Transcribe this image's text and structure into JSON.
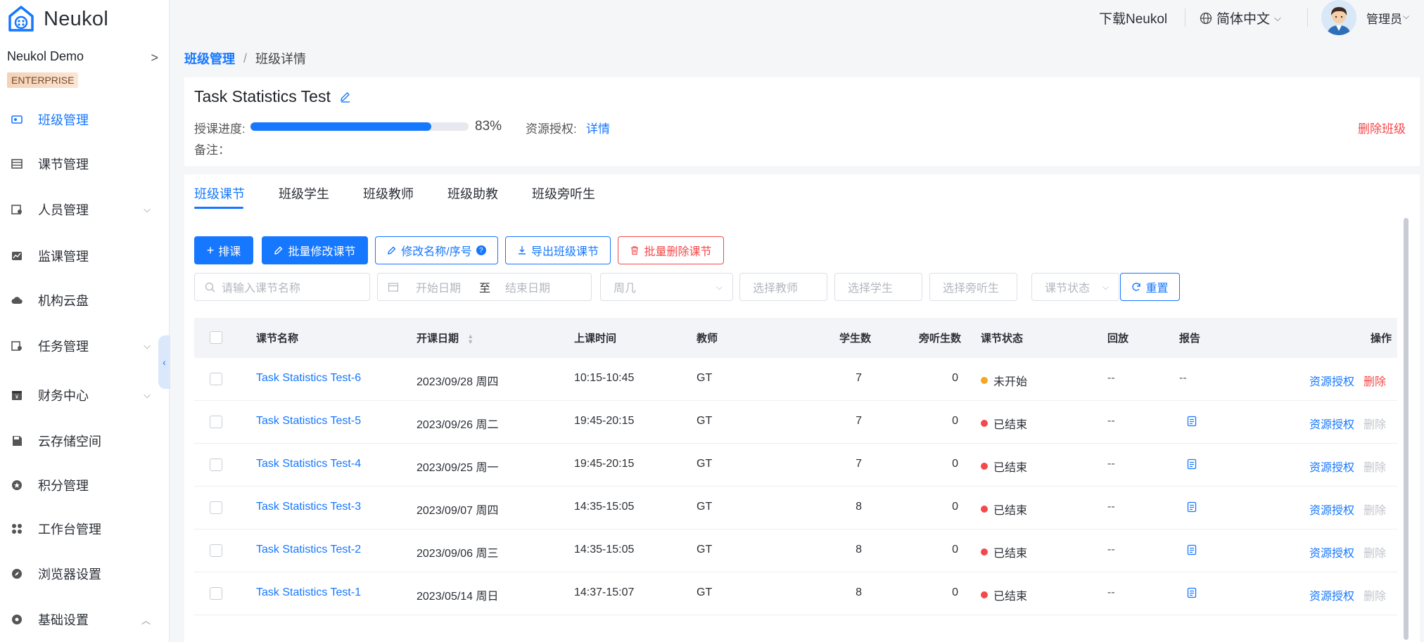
{
  "app": {
    "name": "Neukol",
    "accent": "#1677ff",
    "danger": "#f5484a"
  },
  "sidebar": {
    "org_name": "Neukol Demo",
    "org_badge": "ENTERPRISE",
    "items": [
      {
        "label": "班级管理",
        "icon": "class-icon",
        "active": true,
        "chevron": ""
      },
      {
        "label": "课节管理",
        "icon": "lesson-icon",
        "active": false,
        "chevron": ""
      },
      {
        "label": "人员管理",
        "icon": "people-icon",
        "active": false,
        "chevron": "⌵"
      },
      {
        "label": "监课管理",
        "icon": "monitor-icon",
        "active": false,
        "chevron": ""
      },
      {
        "label": "机构云盘",
        "icon": "cloud-icon",
        "active": false,
        "chevron": ""
      },
      {
        "label": "任务管理",
        "icon": "task-icon",
        "active": false,
        "chevron": "⌵"
      },
      {
        "label": "财务中心",
        "icon": "finance-icon",
        "active": false,
        "chevron": "⌵"
      },
      {
        "label": "云存储空间",
        "icon": "storage-icon",
        "active": false,
        "chevron": ""
      },
      {
        "label": "积分管理",
        "icon": "points-icon",
        "active": false,
        "chevron": ""
      },
      {
        "label": "工作台管理",
        "icon": "workbench-icon",
        "active": false,
        "chevron": ""
      },
      {
        "label": "浏览器设置",
        "icon": "browser-icon",
        "active": false,
        "chevron": ""
      },
      {
        "label": "基础设置",
        "icon": "settings-icon",
        "active": false,
        "chevron": "︿"
      }
    ]
  },
  "header": {
    "download": "下载Neukol",
    "language": "简体中文",
    "user": "管理员"
  },
  "breadcrumb": {
    "parent": "班级管理",
    "sep": "/",
    "current": "班级详情"
  },
  "class_info": {
    "title": "Task Statistics Test",
    "progress_label": "授课进度:",
    "progress_percent": 83,
    "progress_text": "83%",
    "auth_label": "资源授权:",
    "auth_link": "详情",
    "note_label": "备注：",
    "delete_label": "删除班级"
  },
  "tabs": [
    "班级课节",
    "班级学生",
    "班级教师",
    "班级助教",
    "班级旁听生"
  ],
  "toolbar": {
    "schedule": "排课",
    "batch_edit": "批量修改课节",
    "rename": "修改名称/序号",
    "export": "导出班级课节",
    "batch_delete": "批量删除课节"
  },
  "filters": {
    "search_placeholder": "请输入课节名称",
    "start_date": "开始日期",
    "date_to": "至",
    "end_date": "结束日期",
    "weekday": "周几",
    "teacher": "选择教师",
    "student": "选择学生",
    "auditor": "选择旁听生",
    "status": "课节状态",
    "reset": "重置"
  },
  "table": {
    "columns": [
      "课节名称",
      "开课日期",
      "上课时间",
      "教师",
      "学生数",
      "旁听生数",
      "课节状态",
      "回放",
      "报告",
      "操作"
    ],
    "rows": [
      {
        "name": "Task Statistics Test-6",
        "date": "2023/09/28 周四",
        "time": "10:15-10:45",
        "teacher": "GT",
        "students": "7",
        "auditors": "0",
        "status": "未开始",
        "status_color": "#f5a623",
        "replay": "--",
        "report": "--",
        "op_auth": "资源授权",
        "op_delete": "删除",
        "delete_enabled": true
      },
      {
        "name": "Task Statistics Test-5",
        "date": "2023/09/26 周二",
        "time": "19:45-20:15",
        "teacher": "GT",
        "students": "7",
        "auditors": "0",
        "status": "已结束",
        "status_color": "#f5484a",
        "replay": "--",
        "report": "report-icon",
        "op_auth": "资源授权",
        "op_delete": "删除",
        "delete_enabled": false
      },
      {
        "name": "Task Statistics Test-4",
        "date": "2023/09/25 周一",
        "time": "19:45-20:15",
        "teacher": "GT",
        "students": "7",
        "auditors": "0",
        "status": "已结束",
        "status_color": "#f5484a",
        "replay": "--",
        "report": "report-icon",
        "op_auth": "资源授权",
        "op_delete": "删除",
        "delete_enabled": false
      },
      {
        "name": "Task Statistics Test-3",
        "date": "2023/09/07 周四",
        "time": "14:35-15:05",
        "teacher": "GT",
        "students": "8",
        "auditors": "0",
        "status": "已结束",
        "status_color": "#f5484a",
        "replay": "--",
        "report": "report-icon",
        "op_auth": "资源授权",
        "op_delete": "删除",
        "delete_enabled": false
      },
      {
        "name": "Task Statistics Test-2",
        "date": "2023/09/06 周三",
        "time": "14:35-15:05",
        "teacher": "GT",
        "students": "8",
        "auditors": "0",
        "status": "已结束",
        "status_color": "#f5484a",
        "replay": "--",
        "report": "report-icon",
        "op_auth": "资源授权",
        "op_delete": "删除",
        "delete_enabled": false
      },
      {
        "name": "Task Statistics Test-1",
        "date": "2023/05/14 周日",
        "time": "14:37-15:07",
        "teacher": "GT",
        "students": "8",
        "auditors": "0",
        "status": "已结束",
        "status_color": "#f5484a",
        "replay": "--",
        "report": "report-icon",
        "op_auth": "资源授权",
        "op_delete": "删除",
        "delete_enabled": false
      }
    ]
  }
}
